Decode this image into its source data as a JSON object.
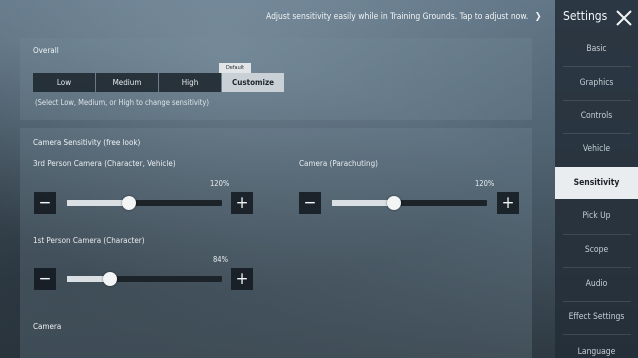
{
  "hint": {
    "text": "Adjust sensitivity easily while in Training Grounds. Tap to adjust now.",
    "arrow_icon": "chevron-right-icon"
  },
  "overall": {
    "title": "Overall",
    "options": [
      "Low",
      "Medium",
      "High",
      "Customize"
    ],
    "selected": "Customize",
    "default_tag": "Default",
    "note": "(Select Low, Medium, or High to change sensitivity)"
  },
  "camera_free_look": {
    "title": "Camera Sensitivity (free look)",
    "sliders": [
      {
        "label": "3rd Person Camera (Character, Vehicle)",
        "value": "120%",
        "percent": 120
      },
      {
        "label": "Camera (Parachuting)",
        "value": "120%",
        "percent": 120
      },
      {
        "label": "1st Person Camera (Character)",
        "value": "84%",
        "percent": 84
      }
    ]
  },
  "camera_section": {
    "title": "Camera"
  },
  "sidebar": {
    "title": "Settings",
    "close_icon": "close-icon",
    "items": [
      "Basic",
      "Graphics",
      "Controls",
      "Vehicle",
      "Sensitivity",
      "Pick Up",
      "Scope",
      "Audio",
      "Effect Settings",
      "Language"
    ],
    "active": "Sensitivity"
  },
  "colors": {
    "sidebar_bg": "#242f39",
    "active_tab_bg": "#e9edf0",
    "segment_active_bg": "#c9d1d6",
    "slider_fill": "#d9dfe3"
  }
}
